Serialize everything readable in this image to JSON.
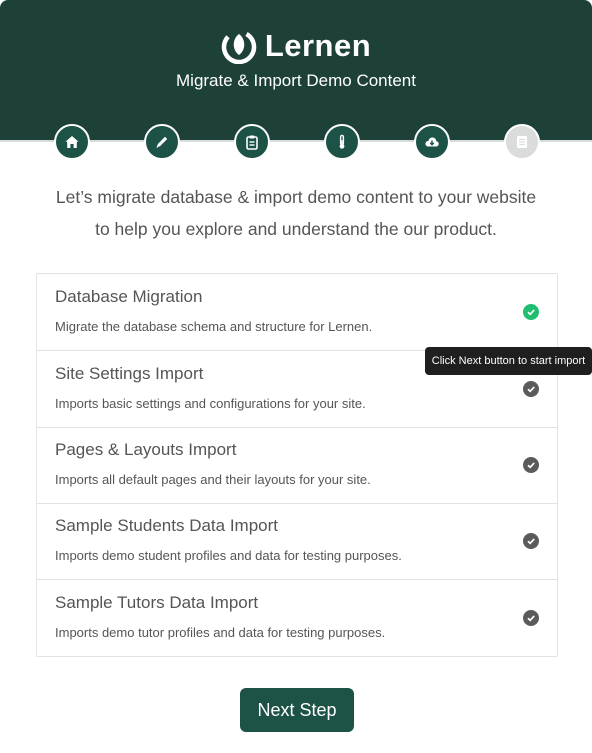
{
  "header": {
    "brand": "Lernen",
    "subtitle": "Migrate & Import Demo Content",
    "brand_color": "#1d4038"
  },
  "steps": [
    {
      "icon": "home-icon",
      "state": "complete"
    },
    {
      "icon": "pencil-icon",
      "state": "complete"
    },
    {
      "icon": "clipboard-icon",
      "state": "complete"
    },
    {
      "icon": "thermometer-icon",
      "state": "complete"
    },
    {
      "icon": "cloud-download-icon",
      "state": "current"
    },
    {
      "icon": "document-icon",
      "state": "pending"
    }
  ],
  "intro": {
    "line1": "Let’s migrate database & import demo content to your website",
    "line2": "to help you explore and understand the our product."
  },
  "tasks": [
    {
      "title": "Database Migration",
      "description": "Migrate the database schema and structure for Lernen.",
      "status": "done"
    },
    {
      "title": "Site Settings Import",
      "description": "Imports basic settings and configurations for your site.",
      "status": "pending"
    },
    {
      "title": "Pages & Layouts Import",
      "description": "Imports all default pages and their layouts for your site.",
      "status": "pending"
    },
    {
      "title": "Sample Students Data Import",
      "description": "Imports demo student profiles and data for testing purposes.",
      "status": "pending"
    },
    {
      "title": "Sample Tutors Data Import",
      "description": "Imports demo tutor profiles and data for testing purposes.",
      "status": "pending"
    }
  ],
  "tooltip": "Click Next button to start import",
  "next_button": "Next Step",
  "colors": {
    "done_check": "#1fbf6f",
    "pending_check": "#5b5b5b",
    "button": "#1d5246"
  }
}
